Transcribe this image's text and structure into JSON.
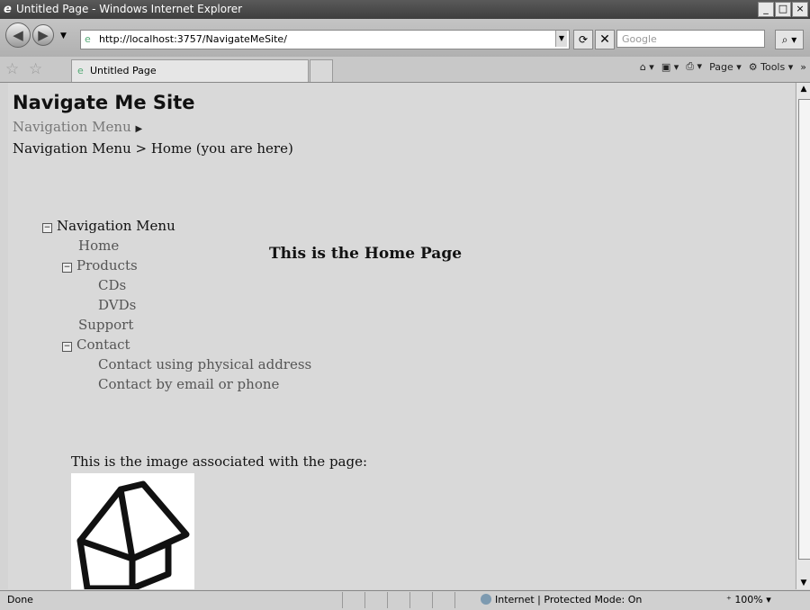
{
  "window": {
    "title": "Untitled Page - Windows Internet Explorer"
  },
  "toolbar": {
    "url": "http://localhost:3757/NavigateMeSite/",
    "search_placeholder": "Google"
  },
  "tabs": [
    {
      "label": "Untitled Page"
    }
  ],
  "command_bar": {
    "page_label": "Page",
    "tools_label": "Tools"
  },
  "page": {
    "site_title": "Navigate Me Site",
    "menu_label": "Navigation Menu",
    "breadcrumb": "Navigation Menu > Home (you are here)",
    "tree": {
      "root": "Navigation Menu",
      "home": "Home",
      "products": "Products",
      "cds": "CDs",
      "dvds": "DVDs",
      "support": "Support",
      "contact": "Contact",
      "contact_physical": "Contact using physical address",
      "contact_email": "Contact by email or phone"
    },
    "heading": "This is the Home Page",
    "image_caption": "This is the image associated with the page:"
  },
  "statusbar": {
    "status": "Done",
    "zone": "Internet | Protected Mode: On",
    "zoom": "100%"
  }
}
